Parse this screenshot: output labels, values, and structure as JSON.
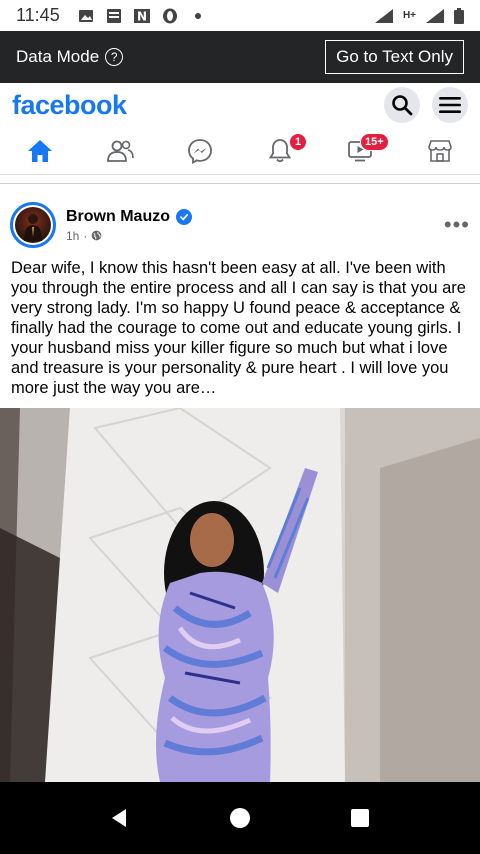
{
  "status_bar": {
    "time": "11:45",
    "signal_label": "H+"
  },
  "data_mode_bar": {
    "label": "Data Mode",
    "help_symbol": "?",
    "text_only_button": "Go to Text Only"
  },
  "header": {
    "logo": "facebook"
  },
  "nav": {
    "notifications_badge": "1",
    "watch_badge": "15+"
  },
  "post": {
    "author": "Brown Mauzo",
    "time": "1h",
    "more_symbol": "•••",
    "text": "Dear wife, I know this hasn't been easy at all. I've been with you through the entire process and all I can say is that you are very strong lady. I'm so happy U found peace & acceptance & finally had the courage to come out and educate young girls. I your husband miss your killer figure so much but what i love and treasure is your personality & pure heart . I will love you more just the way you are…"
  },
  "colors": {
    "brand": "#1877f2",
    "badge": "#e41e3f",
    "dark_bar": "#242526"
  },
  "icons": [
    "home-icon",
    "friends-icon",
    "messenger-icon",
    "bell-icon",
    "watch-icon",
    "marketplace-icon",
    "search-icon",
    "menu-icon",
    "globe-icon",
    "verified-icon"
  ]
}
